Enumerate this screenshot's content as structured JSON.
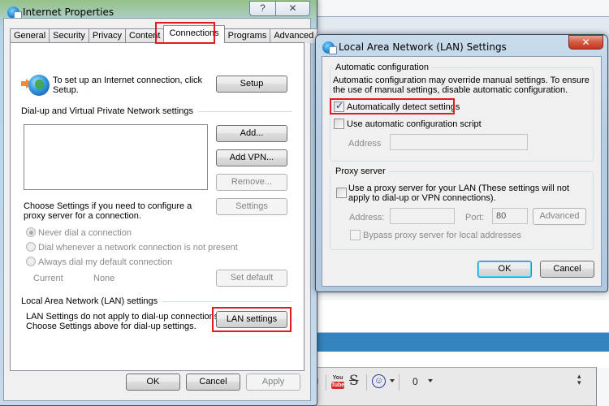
{
  "background": {
    "editor_toolbar": {
      "icons": [
        "hash-icon",
        "youtube-icon",
        "strikethrough-icon",
        "smiley-icon",
        "attachment-icon",
        "expand-collapse-icon"
      ],
      "hash_glyph": "#",
      "youtube_top": "You",
      "youtube_bottom": "Tube",
      "strike_glyph": "S",
      "smiley_glyph": "☺",
      "attach_glyph": "0",
      "updown_glyph": "≛"
    }
  },
  "internet_properties": {
    "title": "Internet Properties",
    "help_glyph": "?",
    "close_glyph": "✕",
    "tabs": [
      {
        "label": "General",
        "active": false
      },
      {
        "label": "Security",
        "active": false
      },
      {
        "label": "Privacy",
        "active": false
      },
      {
        "label": "Content",
        "active": false
      },
      {
        "label": "Connections",
        "active": true
      },
      {
        "label": "Programs",
        "active": false
      },
      {
        "label": "Advanced",
        "active": false
      }
    ],
    "setup_text": "To set up an Internet connection, click Setup.",
    "setup_button": "Setup",
    "dialup_group_label": "Dial-up and Virtual Private Network settings",
    "add_button": "Add...",
    "add_vpn_button": "Add VPN...",
    "remove_button": "Remove...",
    "proxy_text": "Choose Settings if you need to configure a proxy server for a connection.",
    "settings_button": "Settings",
    "radios": [
      {
        "label": "Never dial a connection",
        "checked": true
      },
      {
        "label": "Dial whenever a network connection is not present",
        "checked": false
      },
      {
        "label": "Always dial my default connection",
        "checked": false
      }
    ],
    "current_label": "Current",
    "current_value": "None",
    "set_default_button": "Set default",
    "lan_group_label": "Local Area Network (LAN) settings",
    "lan_text_line1": "LAN Settings do not apply to dial-up connections.",
    "lan_text_line2": "Choose Settings above for dial-up settings.",
    "lan_settings_button": "LAN settings",
    "ok_button": "OK",
    "cancel_button": "Cancel",
    "apply_button": "Apply"
  },
  "lan_dialog": {
    "title": "Local Area Network (LAN) Settings",
    "close_glyph": "✕",
    "auto_config_legend": "Automatic configuration",
    "auto_config_desc": "Automatic configuration may override manual settings.  To ensure the use of manual settings, disable automatic configuration.",
    "auto_detect_label": "Automatically detect settings",
    "auto_detect_checked": true,
    "auto_script_label": "Use automatic configuration script",
    "auto_script_checked": false,
    "script_address_label": "Address",
    "script_address_value": "",
    "proxy_legend": "Proxy server",
    "use_proxy_label": "Use a proxy server for your LAN (These settings will not apply to dial-up or VPN connections).",
    "use_proxy_checked": false,
    "proxy_address_label": "Address:",
    "proxy_address_value": "",
    "port_label": "Port:",
    "port_value": "80",
    "advanced_button": "Advanced",
    "bypass_label": "Bypass proxy server for local addresses",
    "bypass_checked": false,
    "ok_button": "OK",
    "cancel_button": "Cancel"
  },
  "highlight_color": "#e01b24"
}
